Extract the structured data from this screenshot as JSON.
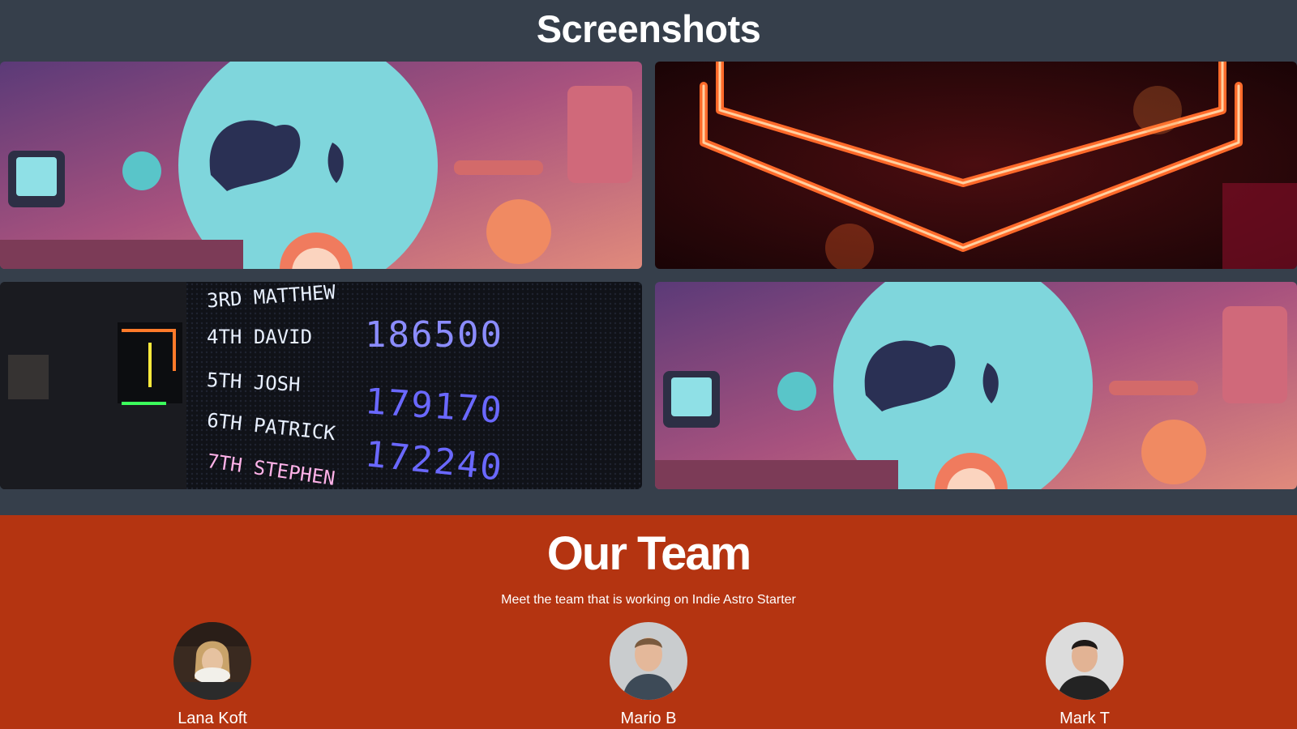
{
  "screenshots": {
    "title": "Screenshots",
    "images": [
      {
        "label": "space-girl-illustration"
      },
      {
        "label": "neon-sign-photo"
      },
      {
        "label": "arcade-scoreboard-photo"
      },
      {
        "label": "space-girl-illustration"
      }
    ],
    "scoreboard": [
      {
        "rank": "3RD",
        "name": "MATTHEW",
        "score": ""
      },
      {
        "rank": "4TH",
        "name": "DAVID",
        "score": "186500"
      },
      {
        "rank": "5TH",
        "name": "JOSH",
        "score": ""
      },
      {
        "rank": "6TH",
        "name": "PATRICK",
        "score": "179170"
      },
      {
        "rank": "7TH",
        "name": "STEPHEN",
        "score": "172240"
      }
    ]
  },
  "team": {
    "title": "Our Team",
    "subtitle": "Meet the team that is working on Indie Astro Starter",
    "members": [
      {
        "name": "Lana Koft"
      },
      {
        "name": "Mario B"
      },
      {
        "name": "Mark T"
      }
    ]
  },
  "colors": {
    "screens_bg": "#363f4b",
    "team_bg": "#b43411"
  }
}
